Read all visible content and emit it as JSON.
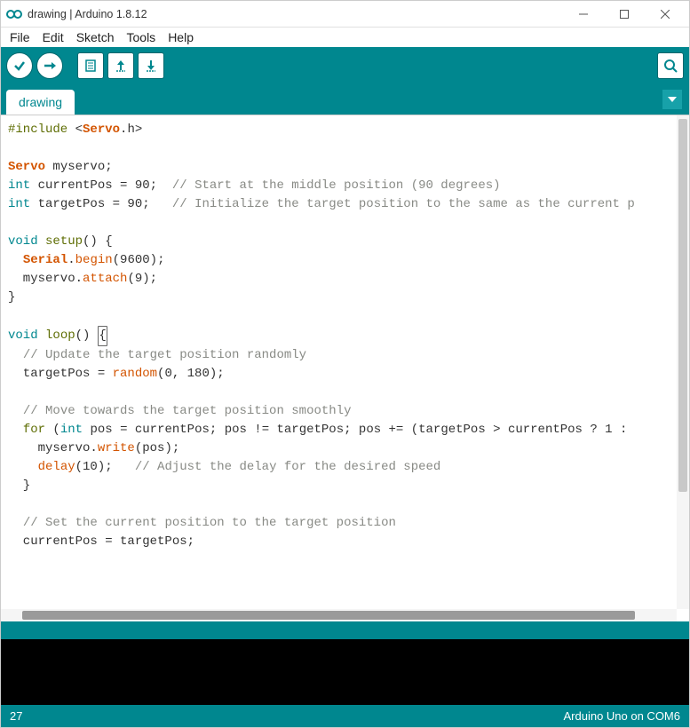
{
  "window": {
    "title": "drawing | Arduino 1.8.12"
  },
  "menu": {
    "file": "File",
    "edit": "Edit",
    "sketch": "Sketch",
    "tools": "Tools",
    "help": "Help"
  },
  "tabs": {
    "active": "drawing"
  },
  "status": {
    "line": "27",
    "board": "Arduino Uno on COM6"
  },
  "colors": {
    "teal": "#00878F",
    "text": "#333333"
  },
  "code": {
    "lines": [
      {
        "t": "include",
        "parts": [
          "#include ",
          "<",
          "Servo",
          ".h>"
        ]
      },
      {
        "t": "blank"
      },
      {
        "t": "decl",
        "parts": [
          "Servo",
          " myservo;"
        ]
      },
      {
        "t": "decl2",
        "parts": [
          "int",
          " currentPos = 90;  ",
          "// Start at the middle position (90 degrees)"
        ]
      },
      {
        "t": "decl2",
        "parts": [
          "int",
          " targetPos = 90;   ",
          "// Initialize the target position to the same as the current p"
        ]
      },
      {
        "t": "blank"
      },
      {
        "t": "fnhead",
        "parts": [
          "void",
          " ",
          "setup",
          "() {"
        ]
      },
      {
        "t": "call",
        "indent": 1,
        "parts": [
          "Serial",
          ".",
          "begin",
          "(9600);"
        ]
      },
      {
        "t": "call",
        "indent": 1,
        "parts": [
          "myservo.",
          "attach",
          "(9);"
        ]
      },
      {
        "t": "plain",
        "text": "}"
      },
      {
        "t": "blank"
      },
      {
        "t": "fnhead_cursor",
        "parts": [
          "void",
          " ",
          "loop",
          "() ",
          "{"
        ]
      },
      {
        "t": "cmt",
        "indent": 1,
        "text": "// Update the target position randomly"
      },
      {
        "t": "assign",
        "indent": 1,
        "parts": [
          "targetPos = ",
          "random",
          "(0, 180);"
        ]
      },
      {
        "t": "blank"
      },
      {
        "t": "cmt",
        "indent": 1,
        "text": "// Move towards the target position smoothly"
      },
      {
        "t": "for",
        "indent": 1,
        "parts": [
          "for",
          " (",
          "int",
          " pos = currentPos; pos != targetPos; pos += (targetPos > currentPos ? 1 :"
        ]
      },
      {
        "t": "call",
        "indent": 2,
        "parts": [
          "myservo.",
          "write",
          "(pos);"
        ]
      },
      {
        "t": "delay",
        "indent": 2,
        "parts": [
          "delay",
          "(10);   ",
          "// Adjust the delay for the desired speed"
        ]
      },
      {
        "t": "plain",
        "indent": 1,
        "text": "}"
      },
      {
        "t": "blank"
      },
      {
        "t": "cmt",
        "indent": 1,
        "text": "// Set the current position to the target position"
      },
      {
        "t": "plain",
        "indent": 1,
        "text": "currentPos = targetPos;"
      }
    ]
  }
}
